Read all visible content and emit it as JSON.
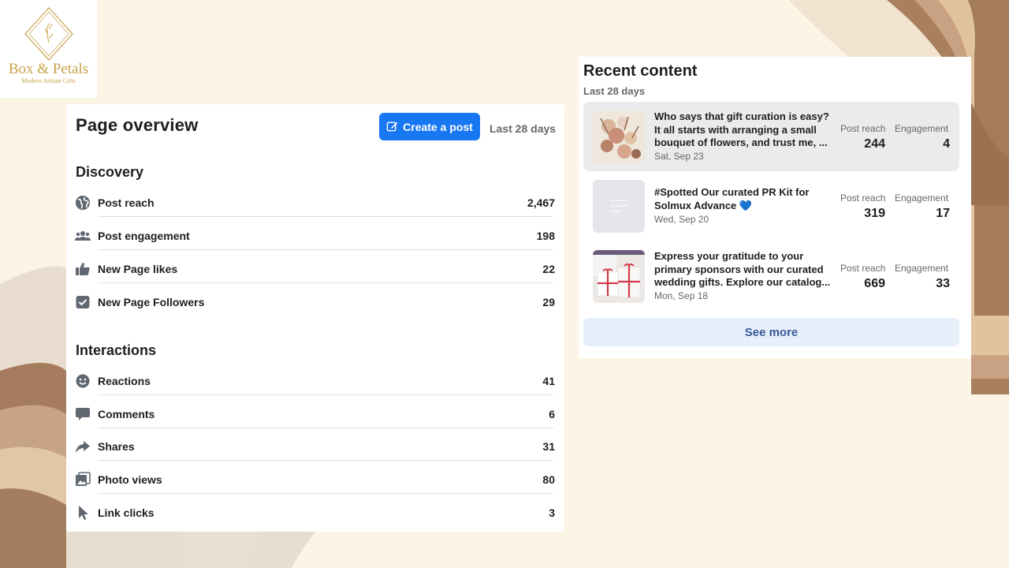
{
  "logo": {
    "brand": "Box & Petals",
    "tagline": "Modern Artisan Gifts"
  },
  "overview": {
    "title": "Page overview",
    "create_post_label": "Create a post",
    "range": "Last 28 days",
    "discovery": {
      "title": "Discovery",
      "rows": [
        {
          "label": "Post reach",
          "value": "2,467",
          "icon": "globe-icon"
        },
        {
          "label": "Post engagement",
          "value": "198",
          "icon": "people-icon"
        },
        {
          "label": "New Page likes",
          "value": "22",
          "icon": "thumbs-up-icon"
        },
        {
          "label": "New Page Followers",
          "value": "29",
          "icon": "followers-check-icon"
        }
      ]
    },
    "interactions": {
      "title": "Interactions",
      "rows": [
        {
          "label": "Reactions",
          "value": "41",
          "icon": "smiley-icon"
        },
        {
          "label": "Comments",
          "value": "6",
          "icon": "comment-bubble-icon"
        },
        {
          "label": "Shares",
          "value": "31",
          "icon": "share-arrow-icon"
        },
        {
          "label": "Photo views",
          "value": "80",
          "icon": "photos-icon"
        },
        {
          "label": "Link clicks",
          "value": "3",
          "icon": "cursor-icon"
        }
      ]
    }
  },
  "recent": {
    "title": "Recent content",
    "range": "Last 28 days",
    "reach_header": "Post reach",
    "engagement_header": "Engagement",
    "posts": [
      {
        "text": "Who says that gift curation is easy? It all starts with arranging a small bouquet of flowers, and trust me, ...",
        "date": "Sat, Sep 23",
        "reach": "244",
        "engagement": "4"
      },
      {
        "text": "#Spotted Our curated PR Kit for Solmux Advance 💙",
        "date": "Wed, Sep 20",
        "reach": "319",
        "engagement": "17"
      },
      {
        "text": "Express your gratitude to your primary sponsors with our curated wedding gifts. Explore our catalog...",
        "date": "Mon, Sep 18",
        "reach": "669",
        "engagement": "33"
      }
    ],
    "see_more_label": "See more"
  }
}
